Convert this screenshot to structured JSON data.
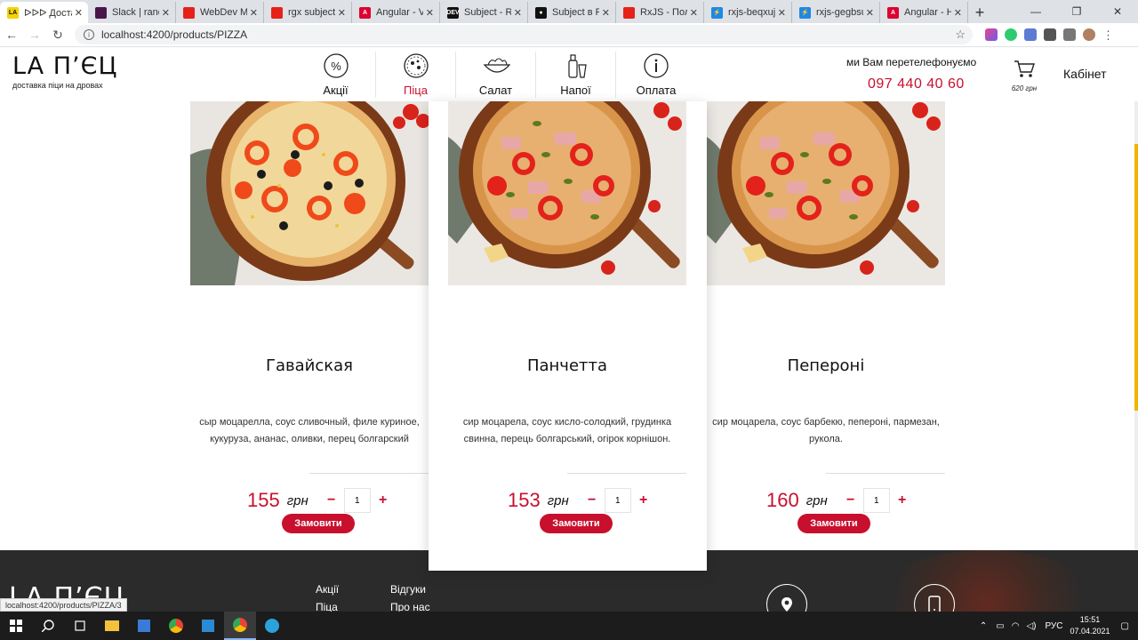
{
  "browser": {
    "tabs": [
      {
        "title": "ᐅᐅᐅ Достав",
        "favicon_color": "#f4d300",
        "favicon_text": "LA",
        "active": true
      },
      {
        "title": "Slack | rando",
        "favicon_color": "#4a154b",
        "favicon_text": ""
      },
      {
        "title": "WebDev MV",
        "favicon_color": "#e62117",
        "favicon_text": ""
      },
      {
        "title": "rgx subject A",
        "favicon_color": "#e62117",
        "favicon_text": ""
      },
      {
        "title": "Angular - Va",
        "favicon_color": "#dd0031",
        "favicon_text": "A"
      },
      {
        "title": "Subject - Rx",
        "favicon_color": "#111111",
        "favicon_text": "DEV"
      },
      {
        "title": "Subject в Rx",
        "favicon_color": "#111111",
        "favicon_text": "●"
      },
      {
        "title": "RxJS - Полн",
        "favicon_color": "#e62117",
        "favicon_text": ""
      },
      {
        "title": "rxjs-beqxuj",
        "favicon_color": "#1e88e5",
        "favicon_text": "⚡"
      },
      {
        "title": "rxjs-gegbsu",
        "favicon_color": "#1e88e5",
        "favicon_text": "⚡"
      },
      {
        "title": "Angular - Ha",
        "favicon_color": "#dd0031",
        "favicon_text": "A"
      }
    ],
    "new_tab": "+",
    "url": "localhost:4200/products/PIZZA",
    "status_url": "localhost:4200/products/PIZZA/3"
  },
  "site": {
    "logo": "LA П’ЄЦ",
    "tagline": "доставка піци на дровах",
    "menu": [
      {
        "label": "Акції",
        "icon": "percent-icon",
        "active": false
      },
      {
        "label": "Піца",
        "icon": "pizza-icon",
        "active": true
      },
      {
        "label": "Салат",
        "icon": "salad-icon",
        "active": false
      },
      {
        "label": "Напої",
        "icon": "drinks-icon",
        "active": false
      },
      {
        "label": "Оплата",
        "icon": "info-icon",
        "active": false
      }
    ],
    "callback_text": "ми Вам перетелефонуємо",
    "phone": "097 440 40 60",
    "cart_total": "620 грн",
    "cabinet": "Кабінет",
    "accent_color": "#c8102e"
  },
  "products": [
    {
      "name": "Гавайская",
      "desc_line1": "сыр моцарелла, соус сливочный, филе куриное,",
      "desc_line2": "кукуруза, ананас, оливки, перец болгарский",
      "price": "155",
      "currency": "грн",
      "qty": "1",
      "order": "Замовити"
    },
    {
      "name": "Панчетта",
      "desc_line1": "сир моцарела, соус кисло-солодкий, грудинка",
      "desc_line2": "свинна, перець болгарський, огірок корнішон.",
      "price": "153",
      "currency": "грн",
      "qty": "1",
      "order": "Замовити"
    },
    {
      "name": "Пепероні",
      "desc_line1": "сир моцарела, соус барбекю, пепероні, пармезан,",
      "desc_line2": "рукола.",
      "price": "160",
      "currency": "грн",
      "qty": "1",
      "order": "Замовити"
    }
  ],
  "footer": {
    "logo": "LA П’ЄЦ",
    "links": [
      "Акції",
      "Відгуки",
      "Піца",
      "Про нас"
    ]
  },
  "taskbar": {
    "lang": "РУС",
    "time": "15:51",
    "date": "07.04.2021"
  }
}
